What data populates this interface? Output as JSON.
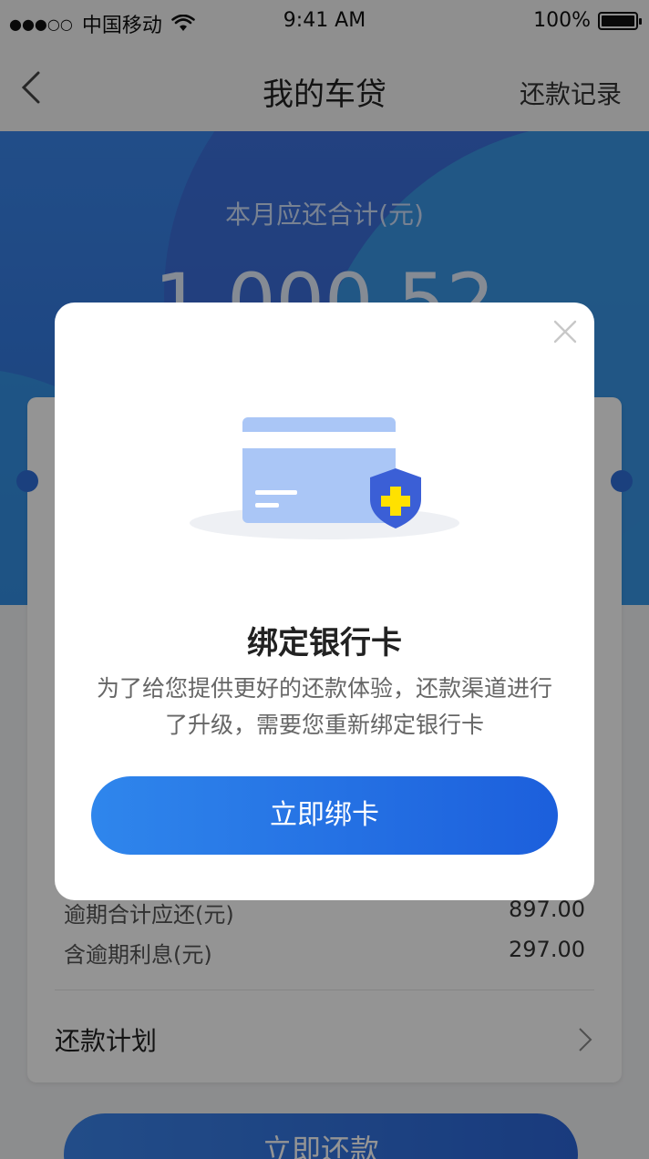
{
  "status_bar": {
    "signal": "●●●○○",
    "carrier": "中国移动",
    "time": "9:41 AM",
    "battery": "100%"
  },
  "nav": {
    "title": "我的车贷",
    "right_action": "还款记录"
  },
  "hero": {
    "label": "本月应还合计(元)",
    "amount": "1,000.52"
  },
  "details": {
    "overdue_total_label": "逾期合计应还(元)",
    "overdue_total_value": "897.00",
    "overdue_interest_label": "含逾期利息(元)",
    "overdue_interest_value": "297.00",
    "plan_label": "还款计划"
  },
  "pay_button": "立即还款",
  "modal": {
    "title": "绑定银行卡",
    "description": "为了给您提供更好的还款体验，还款渠道进行了升级，需要您重新绑定银行卡",
    "button": "立即绑卡"
  },
  "colors": {
    "primary": "#2f6fd9",
    "accent_shield": "#3b5fd6",
    "accent_plus": "#ffe100"
  }
}
